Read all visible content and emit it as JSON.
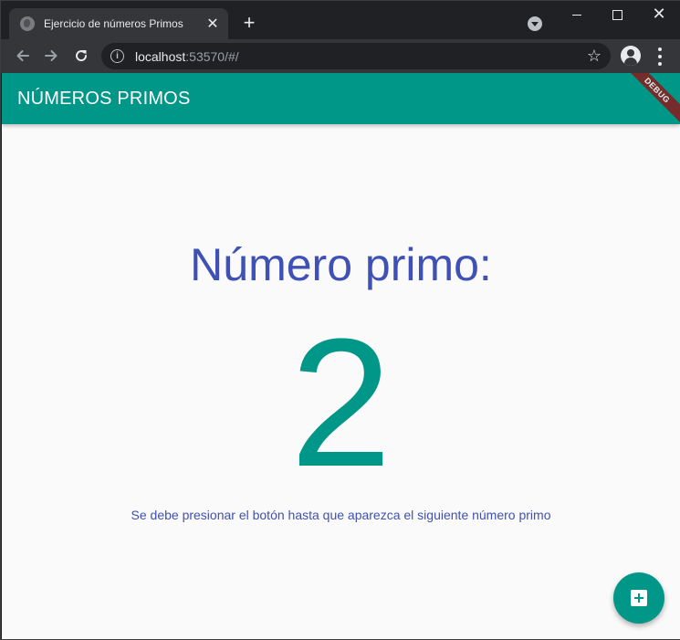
{
  "browser": {
    "tab": {
      "title": "Ejercicio de números Primos",
      "close_glyph": "✕",
      "favicon": "globe-icon"
    },
    "new_tab_glyph": "+",
    "window_controls": {
      "close_glyph": "✕"
    },
    "address_bar": {
      "host": "localhost",
      "rest": ":53570/#/"
    },
    "bookmark_glyph": "☆"
  },
  "app": {
    "appbar_title": "NÚMEROS PRIMOS",
    "debug_banner": "DEBUG",
    "heading": "Número primo:",
    "prime_number": "2",
    "hint": "Se debe presionar el botón hasta que aparezca el siguiente número primo",
    "fab_icon": "add-box-icon"
  },
  "colors": {
    "appbar": "#009688",
    "heading": "#3f51b5",
    "number": "#009688",
    "background": "#fafafa",
    "debug_banner": "#8b1a1a"
  }
}
